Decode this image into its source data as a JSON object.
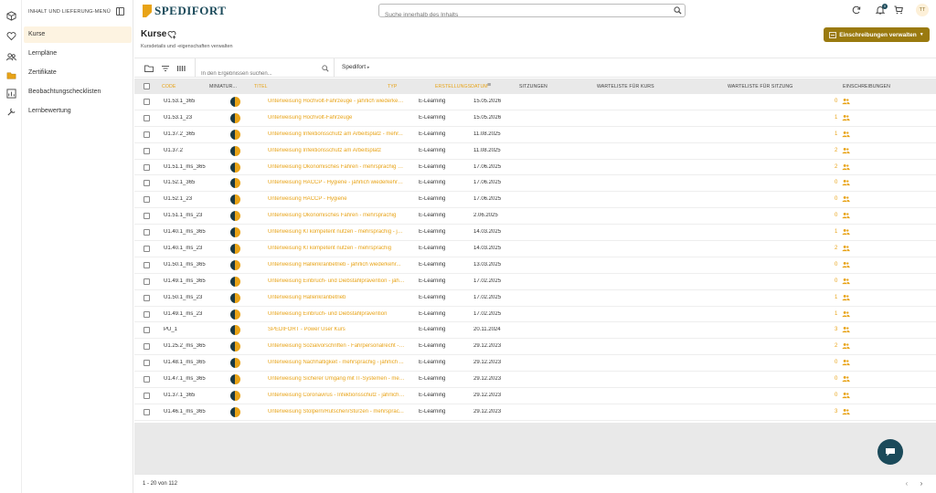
{
  "sidebar": {
    "heading": "INHALT UND LIEFERUNG-MENÜ",
    "items": [
      {
        "label": "Kurse",
        "active": true
      },
      {
        "label": "Lernpläne"
      },
      {
        "label": "Zertifikate"
      },
      {
        "label": "Beobachtungschecklisten"
      },
      {
        "label": "Lernbewertung"
      }
    ]
  },
  "header": {
    "logo_text": "SPEDIFORT",
    "search_placeholder": "Suche innerhalb des Inhalts",
    "notification_count": "0",
    "avatar_initials": "TT"
  },
  "page": {
    "title": "Kurse",
    "subtitle": "Kursdetails und -eigenschaften verwalten",
    "enroll_button": "Einschreibungen verwalten"
  },
  "toolbar": {
    "search_placeholder": "In den Ergebnissen suchen...",
    "filter_label": "Spedifort"
  },
  "table": {
    "columns": [
      "CODE",
      "MINIATUR...",
      "TITEL",
      "TYP",
      "ERSTELLUNGSDATUM",
      "SITZUNGEN",
      "WARTELISTE FÜR KURS",
      "WARTELISTE FÜR SITZUNG",
      "EINSCHREIBUNGEN"
    ],
    "rows": [
      {
        "code": "U1.53.1_365",
        "title": "Unterweisung Hochvolt-Fahrzeuge - jährlich wiederkeh...",
        "type": "E-Learning",
        "date": "15.05.2026",
        "enrollments": "0"
      },
      {
        "code": "U1.53.1_23",
        "title": "Unterweisung Hochvolt-Fahrzeuge",
        "type": "E-Learning",
        "date": "15.05.2026",
        "enrollments": "1"
      },
      {
        "code": "U1.37.2_365",
        "title": "Unterweisung Infektionsschutz am Arbeitsplatz - mehr...",
        "type": "E-Learning",
        "date": "11.08.2025",
        "enrollments": "1"
      },
      {
        "code": "U1.37.2",
        "title": "Unterweisung Infektionsschutz am Arbeitsplatz",
        "type": "E-Learning",
        "date": "11.08.2025",
        "enrollments": "2"
      },
      {
        "code": "U1.51.1_ms_365",
        "title": "Unterweisung Ökonomisches Fahren - mehrsprachig - j...",
        "type": "E-Learning",
        "date": "17.06.2025",
        "enrollments": "2"
      },
      {
        "code": "U1.52.1_365",
        "title": "Unterweisung HACCP - Hygiene - jährlich wiederkehrend",
        "type": "E-Learning",
        "date": "17.06.2025",
        "enrollments": "0"
      },
      {
        "code": "U1.52.1_23",
        "title": "Unterweisung HACCP - Hygiene",
        "type": "E-Learning",
        "date": "17.06.2025",
        "enrollments": "0"
      },
      {
        "code": "U1.51.1_ms_23",
        "title": "Unterweisung Ökonomisches Fahren - mehrsprachig",
        "type": "E-Learning",
        "date": "2.06.2025",
        "enrollments": "0"
      },
      {
        "code": "U1.40.1_ms_365",
        "title": "Unterweisung KI kompetent nutzen - mehrsprachig - jä...",
        "type": "E-Learning",
        "date": "14.03.2025",
        "enrollments": "1"
      },
      {
        "code": "U1.40.1_ms_23",
        "title": "Unterweisung KI kompetent nutzen - mehrsprachig",
        "type": "E-Learning",
        "date": "14.03.2025",
        "enrollments": "2"
      },
      {
        "code": "U1.50.1_ms_365",
        "title": "Unterweisung Hallenkranbetrieb - jährlich wiederkehr...",
        "type": "E-Learning",
        "date": "13.03.2025",
        "enrollments": "0"
      },
      {
        "code": "U1.49.1_ms_365",
        "title": "Unterweisung Einbruch- und Diebstahlprävention - jähr...",
        "type": "E-Learning",
        "date": "17.02.2025",
        "enrollments": "0"
      },
      {
        "code": "U1.50.1_ms_23",
        "title": "Unterweisung Hallenkranbetrieb",
        "type": "E-Learning",
        "date": "17.02.2025",
        "enrollments": "1"
      },
      {
        "code": "U1.49.1_ms_23",
        "title": "Unterweisung Einbruch- und Diebstahlprävention",
        "type": "E-Learning",
        "date": "17.02.2025",
        "enrollments": "1"
      },
      {
        "code": "PU_1",
        "title": "SPEDIFORT - Power User Kurs",
        "type": "E-Learning",
        "date": "20.11.2024",
        "enrollments": "3"
      },
      {
        "code": "U1.25.2_ms_365",
        "title": "Unterweisung Sozialvorschriften - Fahrpersonalrecht - m...",
        "type": "E-Learning",
        "date": "29.12.2023",
        "enrollments": "2"
      },
      {
        "code": "U1.48.1_ms_365",
        "title": "Unterweisung Nachhaltigkeit - mehrsprachig - jährlich ...",
        "type": "E-Learning",
        "date": "29.12.2023",
        "enrollments": "0"
      },
      {
        "code": "U1.47.1_ms_365",
        "title": "Unterweisung Sicherer Umgang mit IT-Systemen - mehr...",
        "type": "E-Learning",
        "date": "29.12.2023",
        "enrollments": "0"
      },
      {
        "code": "U1.37.1_365",
        "title": "Unterweisung Coronavirus - Infektionsschutz - jährlich ...",
        "type": "E-Learning",
        "date": "29.12.2023",
        "enrollments": "0"
      },
      {
        "code": "U1.46.1_ms_365",
        "title": "Unterweisung Stolpern/Rutschen/Stürzen - mehrsprac...",
        "type": "E-Learning",
        "date": "29.12.2023",
        "enrollments": "3"
      }
    ]
  },
  "footer": {
    "pagination": "1 - 20 von 112"
  }
}
